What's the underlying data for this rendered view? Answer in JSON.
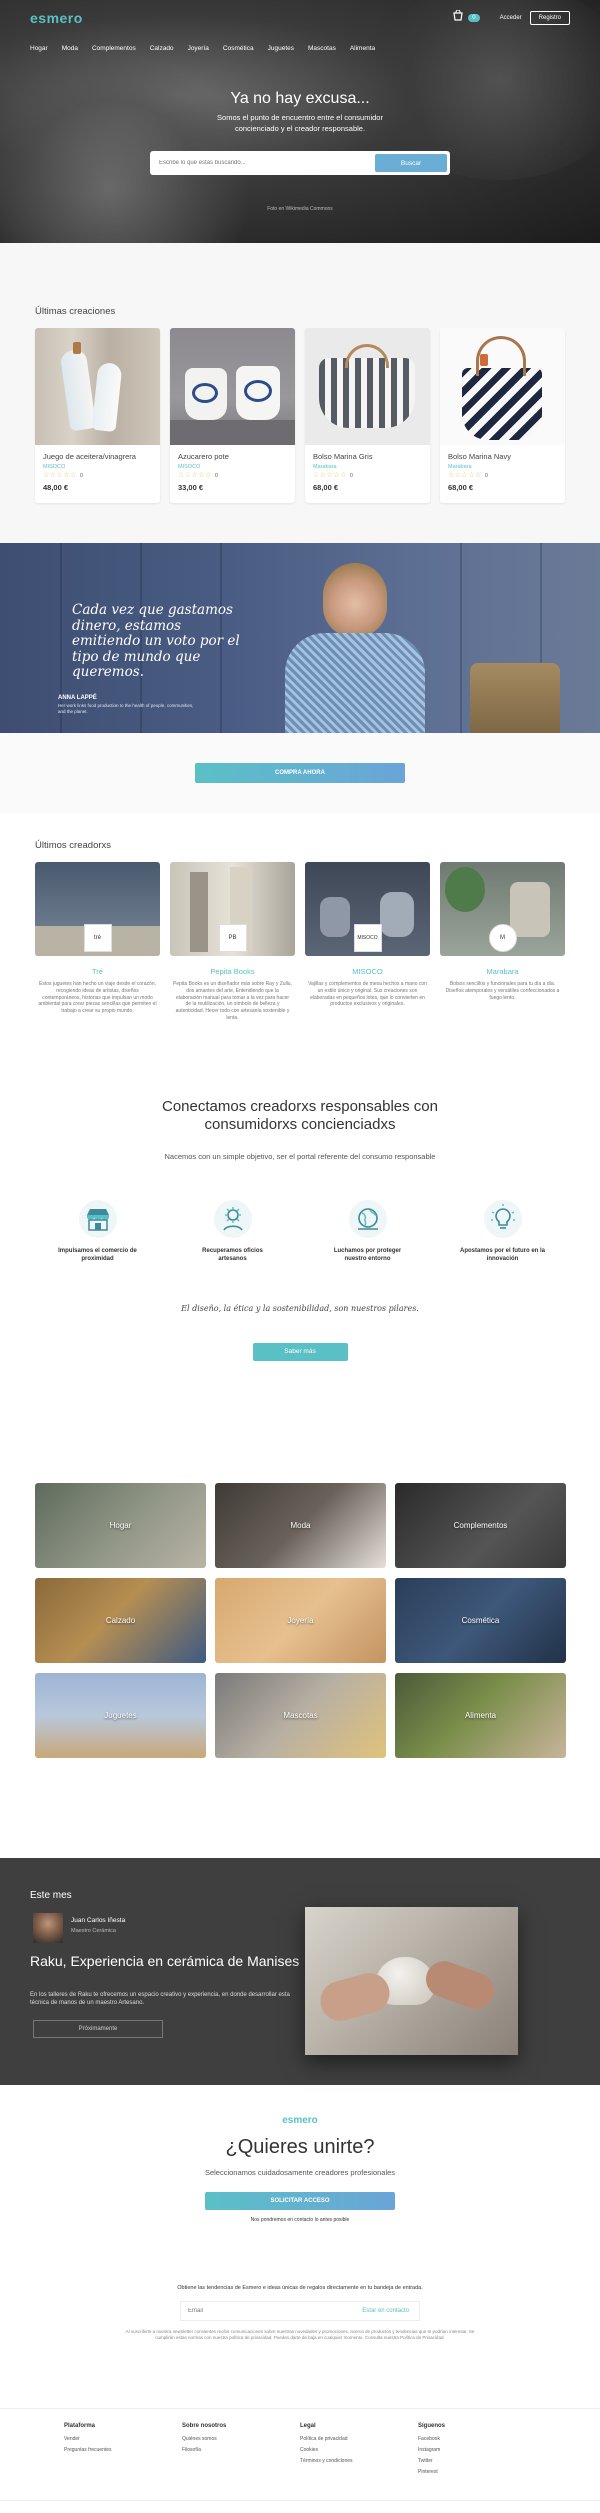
{
  "header": {
    "logo": "esmero",
    "cart_count": "0",
    "login": "Acceder",
    "register": "Registro",
    "nav": [
      "Hogar",
      "Moda",
      "Complementos",
      "Calzado",
      "Joyería",
      "Cosmética",
      "Juguetes",
      "Mascotas",
      "Alimenta"
    ]
  },
  "hero": {
    "title": "Ya no hay excusa...",
    "subtitle_line1": "Somos el punto de encuentro entre el consumidor",
    "subtitle_line2": "concienciado y el creador responsable.",
    "search_placeholder": "Escribe lo que estás buscando...",
    "search_button": "Buscar",
    "photo_credit": "Foto en Wikimedia Commons"
  },
  "creations": {
    "title": "Últimas creaciones",
    "products": [
      {
        "name": "Juego de aceitera/vinagrera",
        "maker": "MISOCO",
        "stars": "☆☆☆☆☆",
        "count": "0",
        "price": "48,00 €"
      },
      {
        "name": "Azucarero pote",
        "maker": "MISOCO",
        "stars": "☆☆☆☆☆",
        "count": "0",
        "price": "33,00 €"
      },
      {
        "name": "Bolso Marina Gris",
        "maker": "Marabara",
        "stars": "☆☆☆☆☆",
        "count": "0",
        "price": "68,00 €"
      },
      {
        "name": "Bolso Marina Navy",
        "maker": "Marabara",
        "stars": "☆☆☆☆☆",
        "count": "0",
        "price": "68,00 €"
      }
    ]
  },
  "quote": {
    "text": "Cada vez que gastamos dinero, estamos emitiendo un voto por el tipo de mundo que queremos.",
    "author": "ANNA LAPPÉ",
    "author_desc": "Her work links food production to the health of people, communities, and the planet.",
    "cta": "COMPRA AHORA"
  },
  "creators": {
    "title": "Últimos creadorxs",
    "items": [
      {
        "logo": "tré",
        "name": "Tré",
        "desc": "Estos juguetes han hecho un viaje desde el corazón, recogiendo ideas de artistas, diseños contemporáneos, historias que impulsan un modo ambiental para crear piezas sencillas que permiten el trabajo a crear su propio mundo."
      },
      {
        "logo": "PB",
        "name": "Pepita Books",
        "desc": "Pepita Books es un diseñador más sobre Ray y Zullu, dos amantes del arte, Entendiendo que la elaboración manual para tomar a la vez para hacer de la reutilización, un símbolo de belleza y autenticidad. Hecer todo con artesanía sostenible y lenta."
      },
      {
        "logo": "MISOCO",
        "name": "MISOCO",
        "desc": "Vajillas y complementos de mesa hechos a mano con un estilo único y original. Sus creaciones son elaboradas en pequeños lotes, que lo convierten en productos exclusivos y originales."
      },
      {
        "logo": "M",
        "name": "Marabara",
        "desc": "Bolsos sencillos y funcionales para tu día a día. Diseños atemporales y versátiles confeccionados a fuego lento."
      }
    ]
  },
  "connect": {
    "title_line1": "Conectamos creadorxs responsables con",
    "title_line2": "consumidorxs concienciadxs",
    "subtitle": "Nacemos con un simple objetivo, ser el portal referente del consumo responsable",
    "features": [
      {
        "icon": "shop-icon",
        "line1": "Impulsamos el comercio de",
        "line2": "proximidad"
      },
      {
        "icon": "craft-icon",
        "line1": "Recuperamos oficios",
        "line2": "artesanos"
      },
      {
        "icon": "earth-icon",
        "line1": "Luchamos por proteger",
        "line2": "nuestro entorno"
      },
      {
        "icon": "idea-icon",
        "line1": "Apostamos por el futuro en la",
        "line2": "innovación"
      }
    ],
    "motto": "El diseño, la ética y la sostenibilidad, son nuestros pilares.",
    "more_button": "Saber más"
  },
  "categories": [
    "Hogar",
    "Moda",
    "Complementos",
    "Calzado",
    "Joyería",
    "Cosmética",
    "Juguetes",
    "Mascotas",
    "Alimenta"
  ],
  "month": {
    "label": "Este mes",
    "author_name": "Juan Carlos Iñesta",
    "author_role": "Maestro Cerámica",
    "title": "Raku, Experiencia en cerámica de Manises",
    "desc": "En los talleres de Raku te ofrecemos un espacio creativo y experiencia, en donde desarrollar esta técnica de manos de un maestro Artesano.",
    "button": "Próximamente"
  },
  "join": {
    "logo": "esmero",
    "title": "¿Quieres unirte?",
    "subtitle": "Seleccionamos cuidadosamente creadores profesionales",
    "button": "SOLICITAR ACCESO",
    "note": "Nos pondremos en contacto lo antes posible"
  },
  "newsletter": {
    "title": "Obtiene las tendencias de Esmero e ideas únicas de regalos directamente en tu bandeja de entrada.",
    "placeholder": "Email",
    "button": "Estar en contacto",
    "legal": "Al suscribirte a nuestra newsletter consientes recibir comunicaciones sobre nuestras novedades y promociones, acerca de productos y tendencias que te podrían interesar. Se cumplirán estas normas con nuestra política de privacidad. Puedes darte de baja en cualquier momento. Consulta nuestra Política de Privacidad."
  },
  "footer": [
    {
      "heading": "Plataforma",
      "items": [
        "Vender",
        "Preguntas frecuentes"
      ]
    },
    {
      "heading": "Sobre nosotros",
      "items": [
        "Quiénes somos",
        "Filosofía"
      ]
    },
    {
      "heading": "Legal",
      "items": [
        "Política de privacidad",
        "Cookies",
        "Términos y condiciones"
      ]
    },
    {
      "heading": "Síguenos",
      "items": [
        "Facebook",
        "Instagram",
        "Twitter",
        "Pinterest"
      ]
    }
  ]
}
